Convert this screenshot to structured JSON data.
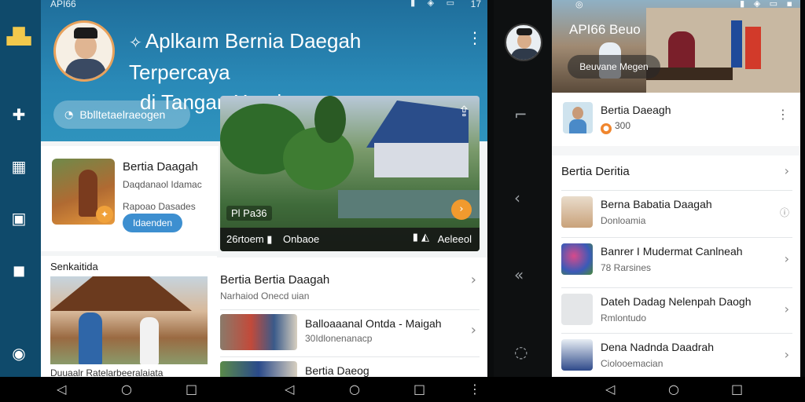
{
  "tablet": {
    "status": {
      "carrier": "API66",
      "time": "17",
      "icons": "▮ ◈ ▭"
    },
    "rail": {
      "items": [
        "app-icon",
        "puzzle-icon",
        "calendar-icon",
        "id-card-icon",
        "chat-icon",
        "help-icon"
      ]
    },
    "header": {
      "title_line1": "Aplkaım Bernia Daegah Terpercaya",
      "title_line2": "di Tangan Xand",
      "search_pill": "Bblltetaelraeogen"
    },
    "feature_card": {
      "title": "Bertia Daagah",
      "subtitle": "Daqdanaol Idamac",
      "subtitle2": "Rapoao Dasades",
      "button": "Idaenden"
    },
    "hero": {
      "label": "Pl Pa36",
      "footer_left": "26rtoem ▮",
      "footer_mid": "Onbaoe",
      "footer_right": "Aeleeol"
    },
    "section": {
      "heading": "Senkaitida",
      "caption": "Duuaalr Ratelarbeeralaiata"
    },
    "list": {
      "header_title": "Bertia Bertia Daagah",
      "header_sub": "Narhaiod Onecd uian",
      "items": [
        {
          "title": "Balloaaanal Ontda - Maigah",
          "sub": "30Idlonenanacp"
        },
        {
          "title": "Bertia Daeog",
          "sub": ""
        }
      ]
    }
  },
  "phone": {
    "status_left": "◎",
    "status_right": "▮ ◈ ▭ ▪",
    "banner": {
      "title": "API66 Beuo",
      "chip": "Beuvane Megen"
    },
    "profile": {
      "name": "Bertia Daeagh",
      "score": "300"
    },
    "section_title": "Bertia Deritia",
    "rows": [
      {
        "title": "Berna Babatia Daagah",
        "sub": "Donloamia"
      },
      {
        "title": "Banrer I Mudermat Canlneah",
        "sub": "78 Rarsines"
      },
      {
        "title": "Dateh Dadag Nelenpah Daogh",
        "sub": "Rmlontudo"
      },
      {
        "title": "Dena Nadnda Daadrah",
        "sub": "Ciolooemacian"
      }
    ]
  },
  "nav": {
    "back": "◁",
    "home": "○",
    "recent": "□",
    "more": "⋮"
  },
  "colors": {
    "rail": "#0f4a6b",
    "header": "#2a8ab8",
    "accent": "#f19a2e",
    "button": "#3d8fd0"
  }
}
